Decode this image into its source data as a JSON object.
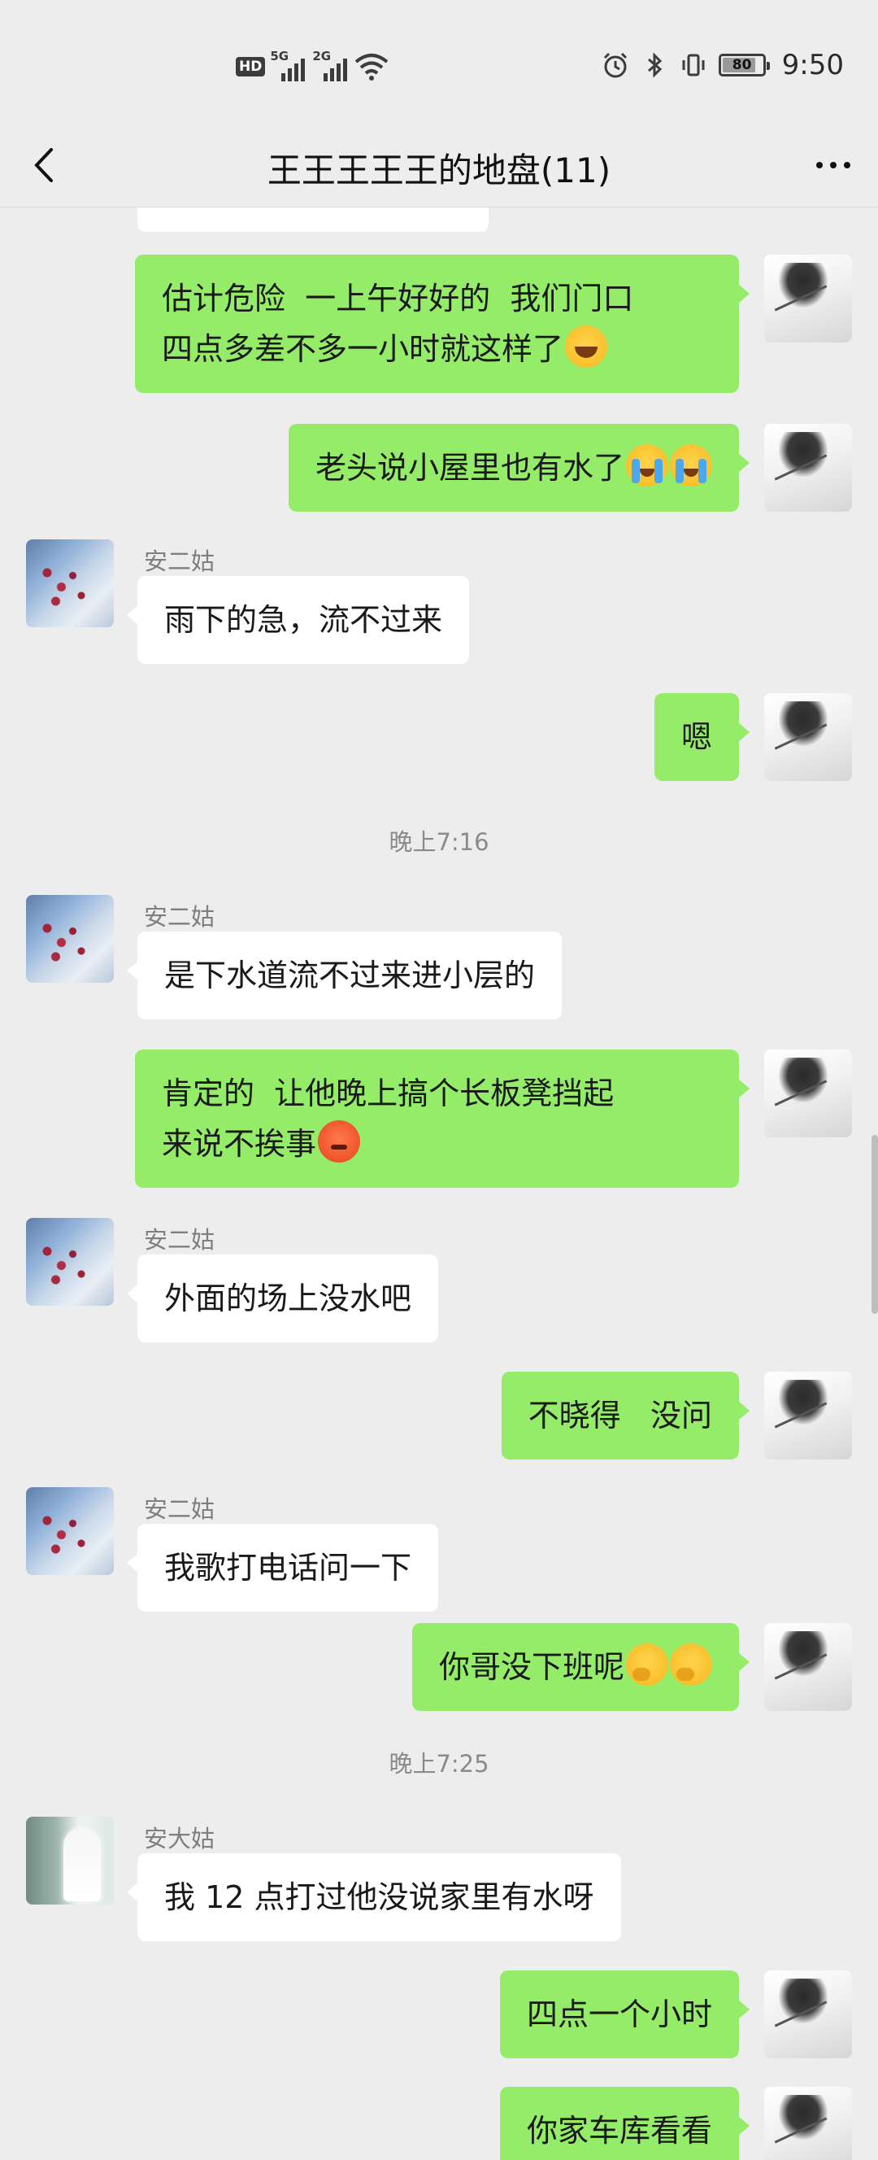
{
  "status_bar": {
    "left_indicators": [
      "HD",
      "5G",
      "2G"
    ],
    "battery_level": "80",
    "time": "9:50",
    "icons": [
      "alarm-icon",
      "bluetooth-icon",
      "vibrate-icon",
      "wifi-icon"
    ]
  },
  "nav": {
    "title": "王王王王王的地盘(11)",
    "back_icon": "chevron-left-icon",
    "more_icon": "more-icon"
  },
  "messages": [
    {
      "side": "self",
      "lines": "估计危险  一上午好好的  我们门口\n四点多差不多一小时就这样了",
      "emoji": "laugh"
    },
    {
      "side": "self",
      "lines": "老头说小屋里也有水了",
      "emoji": "cry2"
    },
    {
      "side": "other",
      "sender": "安二姑",
      "lines": "雨下的急，流不过来"
    },
    {
      "side": "self",
      "lines": "嗯"
    },
    {
      "timestamp": "晚上7:16"
    },
    {
      "side": "other",
      "sender": "安二姑",
      "lines": "是下水道流不过来进小层的"
    },
    {
      "side": "self",
      "lines": "肯定的  让他晚上搞个长板凳挡起\n来说不挨事",
      "emoji": "angry"
    },
    {
      "side": "other",
      "sender": "安二姑",
      "lines": "外面的场上没水吧"
    },
    {
      "side": "self",
      "lines": "不晓得   没问"
    },
    {
      "side": "other",
      "sender": "安二姑",
      "lines": "我歌打电话问一下"
    },
    {
      "side": "self",
      "lines": "你哥没下班呢",
      "emoji": "think2"
    },
    {
      "timestamp": "晚上7:25"
    },
    {
      "side": "other",
      "sender": "安大姑",
      "lines": "我 12 点打过他没说家里有水呀"
    },
    {
      "side": "self",
      "lines": "四点一个小时"
    },
    {
      "side": "self",
      "lines": "你家车库看看"
    }
  ],
  "texts": {
    "m0": "估计危险  一上午好好的  我们门口\n四点多差不多一小时就这样了",
    "m1": "老头说小屋里也有水了",
    "m2_name": "安二姑",
    "m2": "雨下的急，流不过来",
    "m3": "嗯",
    "t1": "晚上7:16",
    "m4_name": "安二姑",
    "m4": "是下水道流不过来进小层的",
    "m5": "肯定的  让他晚上搞个长板凳挡起\n来说不挨事",
    "m6_name": "安二姑",
    "m6": "外面的场上没水吧",
    "m7": "不晓得   没问",
    "m8_name": "安二姑",
    "m8": "我歌打电话问一下",
    "m9": "你哥没下班呢",
    "t2": "晚上7:25",
    "m10_name": "安大姑",
    "m10": "我 12 点打过他没说家里有水呀",
    "m11": "四点一个小时",
    "m12": "你家车库看看"
  },
  "colors": {
    "self_bubble": "#95ec69",
    "other_bubble": "#ffffff",
    "background": "#ededed"
  }
}
